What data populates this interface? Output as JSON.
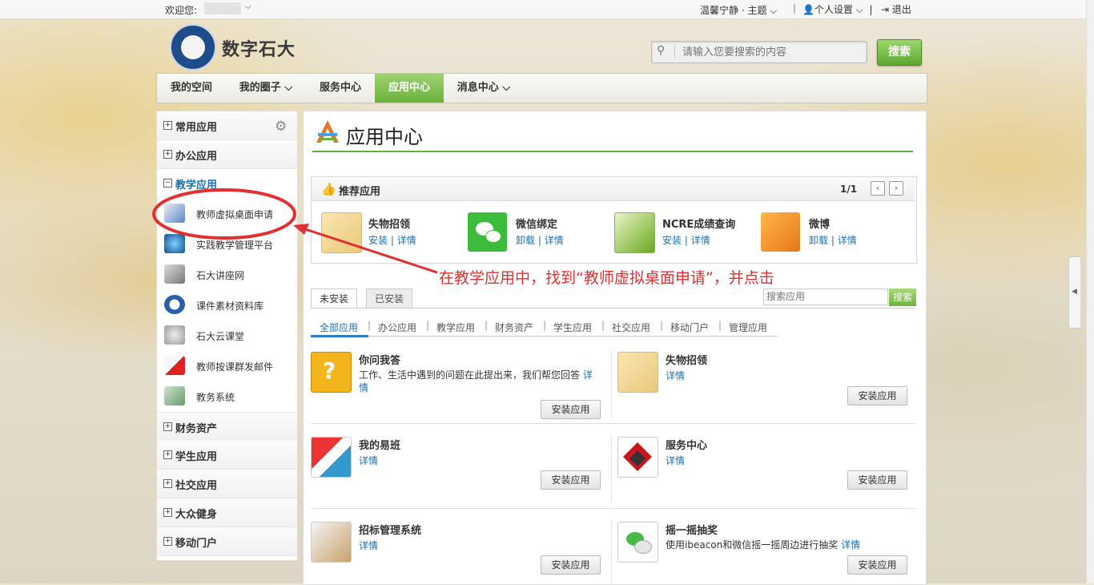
{
  "topbar": {
    "welcome": "欢迎您:",
    "theme": "温馨宁静 · 主题",
    "settings": "个人设置",
    "logout": "退出"
  },
  "header": {
    "site_title": "数字石大",
    "search_placeholder": "请输入您要搜索的内容",
    "search_button": "搜索"
  },
  "nav": {
    "items": [
      {
        "label": "我的空间"
      },
      {
        "label": "我的圈子 ⌵"
      },
      {
        "label": "服务中心"
      },
      {
        "label": "应用中心"
      },
      {
        "label": "消息中心 ⌵"
      }
    ],
    "active": "应用中心"
  },
  "sidebar": {
    "groups": [
      {
        "label": "常用应用",
        "symbol": "+"
      },
      {
        "label": "办公应用",
        "symbol": "+"
      },
      {
        "label": "教学应用",
        "symbol": "−"
      },
      {
        "label": "财务资产",
        "symbol": "+"
      },
      {
        "label": "学生应用",
        "symbol": "+"
      },
      {
        "label": "社交应用",
        "symbol": "+"
      },
      {
        "label": "大众健身",
        "symbol": "+"
      },
      {
        "label": "移动门户",
        "symbol": "+"
      }
    ],
    "teaching_items": [
      {
        "label": "教师虚拟桌面申请"
      },
      {
        "label": "实践教学管理平台"
      },
      {
        "label": "石大讲座网"
      },
      {
        "label": "课件素材资料库"
      },
      {
        "label": "石大云课堂"
      },
      {
        "label": "教师按课群发邮件"
      },
      {
        "label": "教务系统"
      }
    ]
  },
  "main": {
    "title": "应用中心",
    "recommended": {
      "title": "推荐应用",
      "pager": "1/1",
      "apps": [
        {
          "name": "失物招领",
          "link1": "安装",
          "link2": "详情"
        },
        {
          "name": "微信绑定",
          "link1": "卸载",
          "link2": "详情"
        },
        {
          "name": "NCRE成绩查询",
          "link1": "安装",
          "link2": "详情"
        },
        {
          "name": "微博",
          "link1": "卸载",
          "link2": "详情"
        }
      ]
    },
    "annotation": "在教学应用中，找到“教师虚拟桌面申请”，并点击",
    "tabs": [
      {
        "label": "未安装"
      },
      {
        "label": "已安装"
      }
    ],
    "app_search_placeholder": "搜索应用",
    "app_search_button": "搜索",
    "categories": [
      "全部应用",
      "办公应用",
      "教学应用",
      "财务资产",
      "学生应用",
      "社交应用",
      "移动门户",
      "管理应用"
    ],
    "apps": [
      {
        "name": "你问我答",
        "desc": "工作、生活中遇到的问题在此提出来，我们帮您回答",
        "detail": "详情",
        "install": "安装应用"
      },
      {
        "name": "失物招领",
        "desc": "",
        "detail": "详情",
        "install": "安装应用"
      },
      {
        "name": "我的易班",
        "desc": "",
        "detail": "详情",
        "install": "安装应用"
      },
      {
        "name": "服务中心",
        "desc": "",
        "detail": "详情",
        "install": "安装应用"
      },
      {
        "name": "招标管理系统",
        "desc": "",
        "detail": "详情",
        "install": "安装应用"
      },
      {
        "name": "摇一摇抽奖",
        "desc": "使用ibeacon和微信摇一摇周边进行抽奖",
        "detail": "详情",
        "install": "安装应用"
      }
    ]
  },
  "colors": {
    "accent_green": "#6ab23c",
    "link_blue": "#1a6fb0",
    "annotation_red": "#e03030"
  }
}
